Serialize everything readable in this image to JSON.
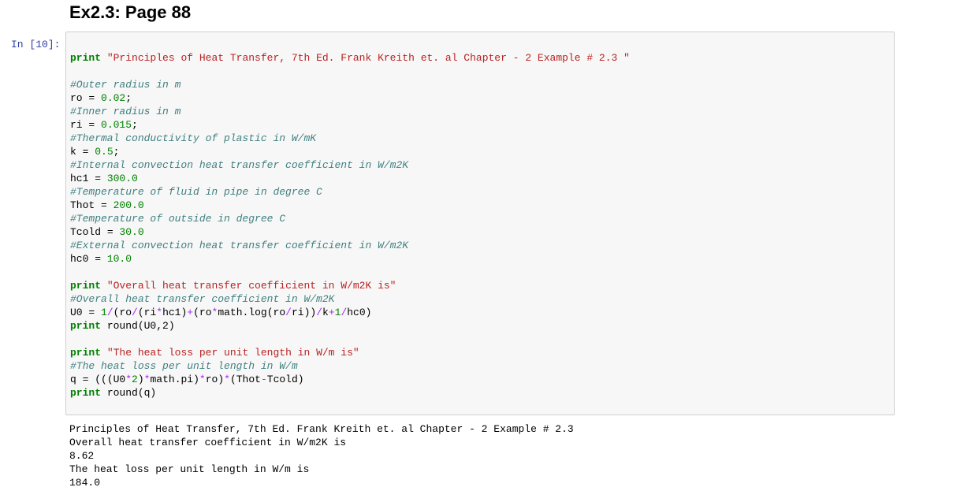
{
  "heading": "Ex2.3: Page 88",
  "prompt": "In [10]:",
  "code": {
    "print_kw": "print",
    "title_str": "\"Principles of Heat Transfer, 7th Ed. Frank Kreith et. al Chapter - 2 Example # 2.3 \"",
    "c_ro": "#Outer radius in m",
    "ro_var": "ro",
    "ro_val": "0.02",
    "c_ri": "#Inner radius in m",
    "ri_var": "ri",
    "ri_val": "0.015",
    "c_k": "#Thermal conductivity of plastic in W/mK",
    "k_var": "k",
    "k_val": "0.5",
    "c_hc1": "#Internal convection heat transfer coefficient in W/m2K",
    "hc1_var": "hc1",
    "hc1_val": "300.0",
    "c_thot": "#Temperature of fluid in pipe in degree C",
    "thot_var": "Thot",
    "thot_val": "200.0",
    "c_tcold": "#Temperature of outside in degree C",
    "tcold_var": "Tcold",
    "tcold_val": "30.0",
    "c_hc0": "#External convection heat transfer coefficient in W/m2K",
    "hc0_var": "hc0",
    "hc0_val": "10.0",
    "overall_str": "\"Overall heat transfer coefficient in W/m2K is\"",
    "c_u0": "#Overall heat transfer coefficient in W/m2K",
    "u0_var": "U0",
    "round_u0": "round(U0,2)",
    "loss_str": "\"The heat loss per unit length in W/m is\"",
    "c_q": "#The heat loss per unit length in W/m",
    "q_var": "q",
    "round_q": "round(q)"
  },
  "output": [
    "Principles of Heat Transfer, 7th Ed. Frank Kreith et. al Chapter - 2 Example # 2.3",
    "Overall heat transfer coefficient in W/m2K is",
    "8.62",
    "The heat loss per unit length in W/m is",
    "184.0"
  ]
}
